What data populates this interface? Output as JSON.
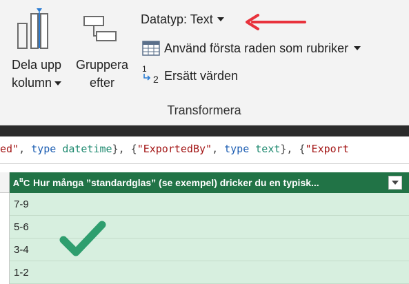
{
  "ribbon": {
    "split_column": {
      "line1": "Dela upp",
      "line2": "kolumn"
    },
    "group_by": {
      "line1": "Gruppera",
      "line2": "efter"
    },
    "data_type": {
      "label": "Datatyp: Text"
    },
    "use_first_row": {
      "label": "Använd första raden som rubriker"
    },
    "replace_values": {
      "label": "Ersätt värden",
      "icon_top": "1",
      "icon_bottom": "2"
    },
    "group_label": "Transformera"
  },
  "formula_bar": {
    "tokens": [
      {
        "t": "ed\"",
        "c": "str"
      },
      {
        "t": ", ",
        "c": "p"
      },
      {
        "t": "type",
        "c": "kw"
      },
      {
        "t": " ",
        "c": "p"
      },
      {
        "t": "datetime",
        "c": "ty"
      },
      {
        "t": "}, {",
        "c": "p"
      },
      {
        "t": "\"ExportedBy\"",
        "c": "str"
      },
      {
        "t": ", ",
        "c": "p"
      },
      {
        "t": "type",
        "c": "kw"
      },
      {
        "t": " ",
        "c": "p"
      },
      {
        "t": "text",
        "c": "ty"
      },
      {
        "t": "}, {",
        "c": "p"
      },
      {
        "t": "\"Export",
        "c": "str"
      }
    ]
  },
  "grid": {
    "column": {
      "type_icon": "ABC",
      "title": "Hur många ”standardglas” (se exempel) dricker du en typisk..."
    },
    "rows": [
      "7-9",
      "5-6",
      "3-4",
      "1-2"
    ]
  },
  "colors": {
    "header_green": "#217346",
    "selected_fill": "#d7efdf",
    "check_green": "#2e9e6e",
    "arrow_red": "#e8323c"
  }
}
